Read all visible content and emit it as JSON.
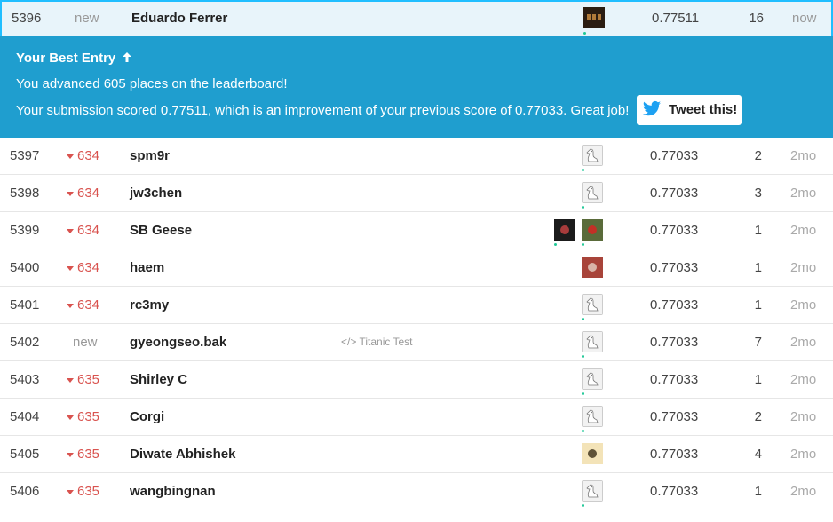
{
  "highlight_row": {
    "rank": "5396",
    "change": "new",
    "team": "Eduardo Ferrer",
    "score": "0.77511",
    "entries": "16",
    "last": "now"
  },
  "banner": {
    "title": "Your Best Entry",
    "line1": "You advanced 605 places on the leaderboard!",
    "line2": "Your submission scored 0.77511, which is an improvement of your previous score of 0.77033. Great job!",
    "tweet_label": "Tweet this!"
  },
  "rows": [
    {
      "rank": "5397",
      "change": "634",
      "team": "spm9r",
      "score": "0.77033",
      "entries": "2",
      "last": "2mo"
    },
    {
      "rank": "5398",
      "change": "634",
      "team": "jw3chen",
      "score": "0.77033",
      "entries": "3",
      "last": "2mo"
    },
    {
      "rank": "5399",
      "change": "634",
      "team": "SB Geese",
      "score": "0.77033",
      "entries": "1",
      "last": "2mo"
    },
    {
      "rank": "5400",
      "change": "634",
      "team": "haem",
      "score": "0.77033",
      "entries": "1",
      "last": "2mo"
    },
    {
      "rank": "5401",
      "change": "634",
      "team": "rc3my",
      "score": "0.77033",
      "entries": "1",
      "last": "2mo"
    },
    {
      "rank": "5402",
      "change": "new",
      "team": "gyeongseo.bak",
      "kernel": "Titanic Test",
      "score": "0.77033",
      "entries": "7",
      "last": "2mo"
    },
    {
      "rank": "5403",
      "change": "635",
      "team": "Shirley C",
      "score": "0.77033",
      "entries": "1",
      "last": "2mo"
    },
    {
      "rank": "5404",
      "change": "635",
      "team": "Corgi",
      "score": "0.77033",
      "entries": "2",
      "last": "2mo"
    },
    {
      "rank": "5405",
      "change": "635",
      "team": "Diwate Abhishek",
      "score": "0.77033",
      "entries": "4",
      "last": "2mo"
    },
    {
      "rank": "5406",
      "change": "635",
      "team": "wangbingnan",
      "score": "0.77033",
      "entries": "1",
      "last": "2mo"
    }
  ],
  "colors": {
    "banner": "#1f9ecf",
    "down": "#d9534f",
    "highlight_border": "#20beff"
  },
  "icons": {
    "up": "arrow-up-icon",
    "down": "caret-down-icon",
    "twitter": "twitter-bird-icon",
    "code": "code-icon",
    "avatar_default": "goose-avatar-icon"
  }
}
